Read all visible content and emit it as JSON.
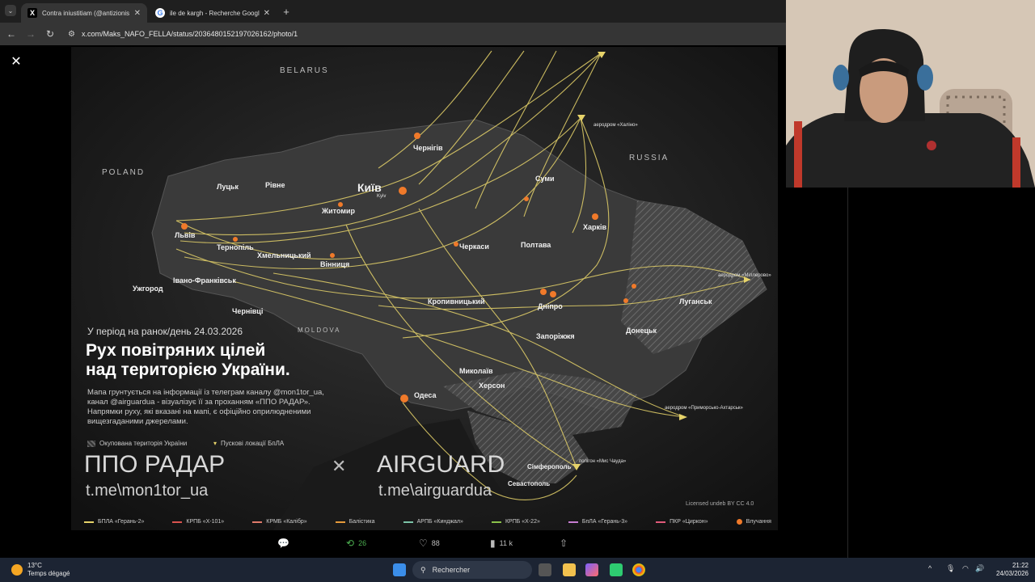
{
  "browser": {
    "tabs": [
      {
        "title": "Contra iniustitiam (@antizionis",
        "favicon": "X",
        "active": true
      },
      {
        "title": "ile de kargh - Recherche Googl",
        "favicon": "G",
        "active": false
      }
    ],
    "new_tab": "+",
    "url": "x.com/Maks_NAFO_FELLA/status/2036480152197026162/photo/1"
  },
  "map": {
    "countries": {
      "belarus": "BELARUS",
      "poland": "POLAND",
      "russia": "RUSSIA",
      "moldova": "MOLDOVA"
    },
    "cities": {
      "kyiv": "Київ",
      "kyiv_sub": "Kyiv",
      "chernihiv": "Чернігів",
      "sumy": "Суми",
      "kharkiv": "Харків",
      "poltava": "Полтава",
      "zhytomyr": "Житомир",
      "rivne": "Рівне",
      "lutsk": "Луцьк",
      "lviv": "Львів",
      "ternopil": "Тернопіль",
      "khmelnytskyi": "Хмельницький",
      "vinnytsia": "Вінниця",
      "cherkasy": "Черкаси",
      "ivano_frankivsk": "Івано-Франківськ",
      "uzhhorod": "Ужгород",
      "chernivtsi": "Чернівці",
      "kropyvnytskyi": "Кропивницький",
      "dnipro": "Дніпро",
      "zaporizhzhia": "Запоріжжя",
      "donetsk": "Донецьк",
      "luhansk": "Луганськ",
      "mykolaiv": "Миколаїв",
      "kherson": "Херсон",
      "odesa": "Одеса",
      "simferopol": "Сімферополь",
      "sevastopol": "Севастополь"
    },
    "airfields": {
      "khalino": "аеродром «Халіно»",
      "millerovo": "аеродром «Міллерово»",
      "primorsko": "аеродром «Приморсько-Ахтарськ»",
      "chauda": "полігон «Мис Чауда»"
    },
    "date_line": "У період на ранок/день 24.03.2026",
    "title_line1": "Рух повітряних цілей",
    "title_line2": "над територією України.",
    "description": "Мапа грунтується на інформації із телеграм каналу @mon1tor_ua, канал @airguardua - візуалізує її за проханням «ППО РАДАР». Напрямки руху, які вказані на мапі, є офіційно оприлюдненими вищезгаданими джерелами.",
    "legend_occupied": "Окупована територія України",
    "legend_launch": "Пускові локації БпЛА",
    "brand1": "ППО РАДАР",
    "brand1_link": "t.me\\mon1tor_ua",
    "brand_sep": "✕",
    "brand2": "AIRGUARD",
    "brand2_link": "t.me\\airguardua",
    "license": "Licensed undeb BY CC 4.0",
    "bottom_legend": [
      {
        "label": "БПЛА «Герань-2»",
        "color": "#e6d36a"
      },
      {
        "label": "КРПБ «Х-101»",
        "color": "#d9534f"
      },
      {
        "label": "КРМБ «Калібр»",
        "color": "#e07b6b"
      },
      {
        "label": "Балістика",
        "color": "#e59a3b"
      },
      {
        "label": "АРПБ «Кинджал»",
        "color": "#7cc4a8"
      },
      {
        "label": "КРПБ «Х-22»",
        "color": "#8bc34a"
      },
      {
        "label": "БпЛА «Герань-3»",
        "color": "#c77dd1"
      },
      {
        "label": "ПКР «Циркон»",
        "color": "#e05a7a"
      },
      {
        "label": "Влучання",
        "color": "#f07a2a"
      }
    ]
  },
  "engagement": {
    "replies": "",
    "reposts": "26",
    "likes": "88",
    "views": "11 k"
  },
  "taskbar": {
    "weather_temp": "13°C",
    "weather_desc": "Temps dégagé",
    "search_placeholder": "Rechercher",
    "time": "21:22",
    "date": "24/03/2026"
  },
  "colors": {
    "route": "#e6d36a",
    "occupied": "#5a5a5a",
    "land": "#3a3a3a",
    "accent_green": "#4caf50"
  }
}
